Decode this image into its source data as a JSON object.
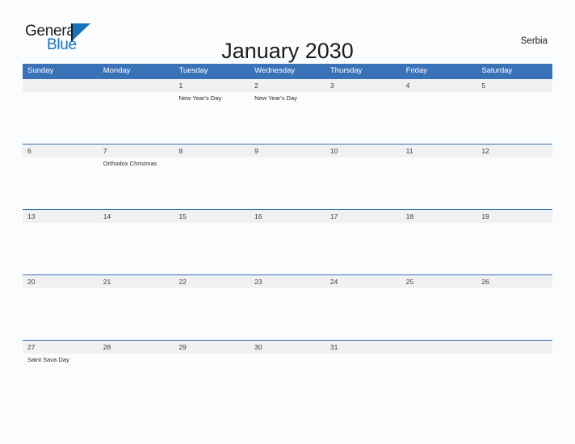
{
  "brand": {
    "word_one": "General",
    "word_two": "Blue",
    "mark_icon": "triangle-logo-icon"
  },
  "header": {
    "title": "January 2030",
    "country": "Serbia"
  },
  "calendar": {
    "weekday_headers": [
      "Sunday",
      "Monday",
      "Tuesday",
      "Wednesday",
      "Thursday",
      "Friday",
      "Saturday"
    ],
    "accent_color": "#3a72b8",
    "band_color": "#f0f1f2",
    "weeks": [
      {
        "days": [
          {
            "num": "",
            "event": ""
          },
          {
            "num": "",
            "event": ""
          },
          {
            "num": "1",
            "event": "New Year's Day"
          },
          {
            "num": "2",
            "event": "New Year's Day"
          },
          {
            "num": "3",
            "event": ""
          },
          {
            "num": "4",
            "event": ""
          },
          {
            "num": "5",
            "event": ""
          }
        ]
      },
      {
        "days": [
          {
            "num": "6",
            "event": ""
          },
          {
            "num": "7",
            "event": "Orthodox Christmas"
          },
          {
            "num": "8",
            "event": ""
          },
          {
            "num": "9",
            "event": ""
          },
          {
            "num": "10",
            "event": ""
          },
          {
            "num": "11",
            "event": ""
          },
          {
            "num": "12",
            "event": ""
          }
        ]
      },
      {
        "days": [
          {
            "num": "13",
            "event": ""
          },
          {
            "num": "14",
            "event": ""
          },
          {
            "num": "15",
            "event": ""
          },
          {
            "num": "16",
            "event": ""
          },
          {
            "num": "17",
            "event": ""
          },
          {
            "num": "18",
            "event": ""
          },
          {
            "num": "19",
            "event": ""
          }
        ]
      },
      {
        "days": [
          {
            "num": "20",
            "event": ""
          },
          {
            "num": "21",
            "event": ""
          },
          {
            "num": "22",
            "event": ""
          },
          {
            "num": "23",
            "event": ""
          },
          {
            "num": "24",
            "event": ""
          },
          {
            "num": "25",
            "event": ""
          },
          {
            "num": "26",
            "event": ""
          }
        ]
      },
      {
        "days": [
          {
            "num": "27",
            "event": "Saint Sava Day"
          },
          {
            "num": "28",
            "event": ""
          },
          {
            "num": "29",
            "event": ""
          },
          {
            "num": "30",
            "event": ""
          },
          {
            "num": "31",
            "event": ""
          },
          {
            "num": "",
            "event": ""
          },
          {
            "num": "",
            "event": ""
          }
        ]
      }
    ]
  }
}
